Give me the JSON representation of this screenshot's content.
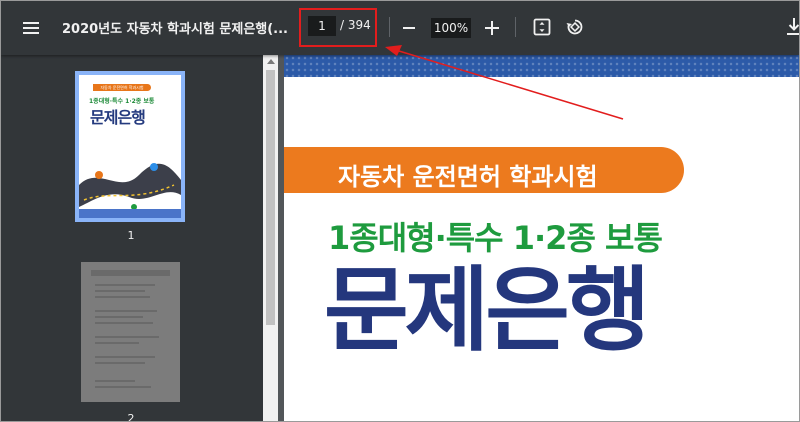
{
  "toolbar": {
    "menu_icon": "hamburger-menu-icon",
    "document_title": "2020년도 자동차 학과시험 문제은행(...",
    "page_current": "1",
    "page_total": "/ 394",
    "zoom_value": "100%",
    "zoom_out_icon": "minus-icon",
    "zoom_in_icon": "plus-icon",
    "fit_icon": "fit-to-page-icon",
    "rotate_icon": "rotate-icon",
    "download_icon": "download-icon"
  },
  "sidebar": {
    "thumbnails": [
      {
        "label": "1",
        "selected": true,
        "banner": "자동차 운전면허 학과시험",
        "subtitle": "1종대형·특수 1·2종 보통",
        "title": "문제은행"
      },
      {
        "label": "2",
        "selected": false
      }
    ]
  },
  "document_page": {
    "banner": "자동차 운전면허 학과시험",
    "subtitle": "1종대형·특수 1·2종 보통",
    "title": "문제은행"
  },
  "annotation": {
    "highlight_color": "#e21d1d",
    "arrow_color": "#e21d1d"
  },
  "colors": {
    "toolbar_bg": "#323639",
    "selected_thumb_border": "#8ab4f8",
    "banner_orange": "#ec7a1e",
    "subtitle_green": "#1e9b3e",
    "title_navy": "#24377d"
  }
}
